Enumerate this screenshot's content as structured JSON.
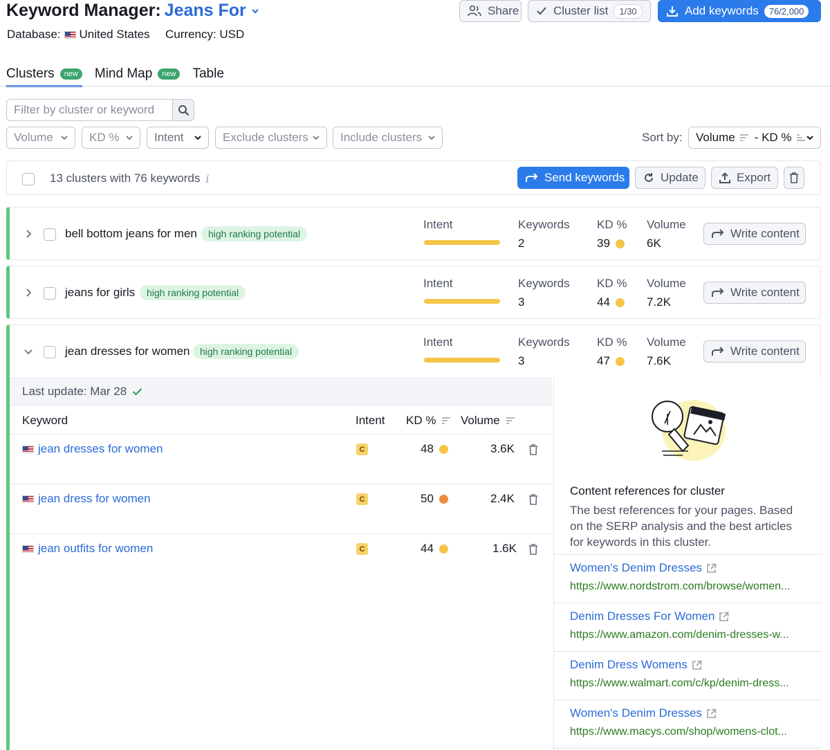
{
  "header": {
    "title_prefix": "Keyword Manager:",
    "project_name": "Jeans For",
    "database_label": "Database:",
    "database_value": "United States",
    "currency_label": "Currency: USD"
  },
  "actions": {
    "share": "Share",
    "cluster_list": "Cluster list",
    "cluster_list_count": "1/30",
    "add_keywords": "Add keywords",
    "add_keywords_count": "76/2,000"
  },
  "tabs": [
    {
      "label": "Clusters",
      "badge": "new"
    },
    {
      "label": "Mind Map",
      "badge": "new"
    },
    {
      "label": "Table",
      "badge": ""
    }
  ],
  "filters": {
    "search_placeholder": "Filter by cluster or keyword",
    "volume": "Volume",
    "kd": "KD %",
    "intent": "Intent",
    "exclude": "Exclude clusters",
    "include": "Include clusters",
    "sort_label": "Sort by:",
    "sort_primary": "Volume",
    "sort_secondary": "- KD %"
  },
  "summary": {
    "text": "13 clusters with 76 keywords",
    "send": "Send keywords",
    "update": "Update",
    "export": "Export"
  },
  "columns": {
    "intent": "Intent",
    "keywords": "Keywords",
    "kd": "KD %",
    "volume": "Volume",
    "write": "Write content"
  },
  "clusters": [
    {
      "name": "bell bottom jeans for men",
      "tag": "high ranking potential",
      "keywords": "2",
      "kd": "39",
      "volume": "6K"
    },
    {
      "name": "jeans for girls",
      "tag": "high ranking potential",
      "keywords": "3",
      "kd": "44",
      "volume": "7.2K"
    },
    {
      "name": "jean dresses for women",
      "tag": "high ranking potential",
      "keywords": "3",
      "kd": "47",
      "volume": "7.6K"
    }
  ],
  "expanded": {
    "last_update": "Last update: Mar 28",
    "headers": {
      "keyword": "Keyword",
      "intent": "Intent",
      "kd": "KD %",
      "volume": "Volume"
    },
    "rows": [
      {
        "keyword": "jean dresses for women",
        "intent": "C",
        "kd": "48",
        "volume": "3.6K",
        "dot": "#f5c548"
      },
      {
        "keyword": "jean dress for women",
        "intent": "C",
        "kd": "50",
        "volume": "2.4K",
        "dot": "#f0883e"
      },
      {
        "keyword": "jean outfits for women",
        "intent": "C",
        "kd": "44",
        "volume": "1.6K",
        "dot": "#f5c548"
      }
    ]
  },
  "references": {
    "title": "Content references for cluster",
    "description": "The best references for your pages. Based on the SERP analysis and the best articles for keywords in this cluster.",
    "items": [
      {
        "title": "Women's Denim Dresses",
        "url": "https://www.nordstrom.com/browse/women..."
      },
      {
        "title": "Denim Dresses For Women",
        "url": "https://www.amazon.com/denim-dresses-w..."
      },
      {
        "title": "Denim Dress Womens",
        "url": "https://www.walmart.com/c/kp/denim-dress..."
      },
      {
        "title": "Women's Denim Dresses",
        "url": "https://www.macys.com/shop/womens-clot..."
      }
    ]
  },
  "colors": {
    "accent": "#2b6bd6",
    "primary_button": "#2b7bea",
    "cluster_border": "#5ec77f",
    "kd_easy": "#f5c548",
    "kd_hard": "#f0883e",
    "intent_bar": "#f5c548"
  }
}
